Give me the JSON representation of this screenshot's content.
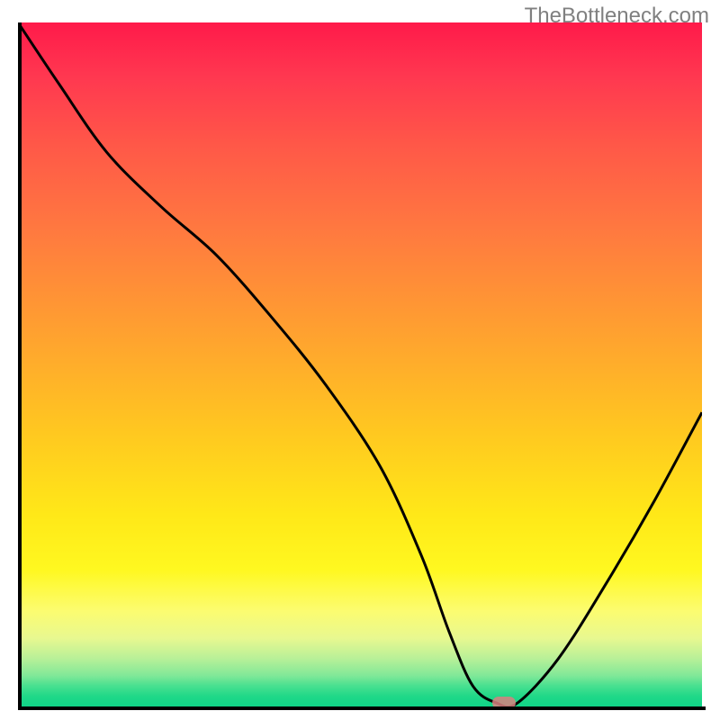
{
  "watermark": "TheBottleneck.com",
  "chart_data": {
    "type": "line",
    "title": "",
    "xlabel": "",
    "ylabel": "",
    "xlim": [
      0,
      100
    ],
    "ylim": [
      0,
      100
    ],
    "grid": false,
    "legend": false,
    "background": {
      "gradient": "vertical",
      "stops": [
        {
          "pos": 0,
          "color": "#ff1a4a"
        },
        {
          "pos": 0.5,
          "color": "#ffc820"
        },
        {
          "pos": 0.85,
          "color": "#fcfc70"
        },
        {
          "pos": 1.0,
          "color": "#10d488"
        }
      ]
    },
    "series": [
      {
        "name": "bottleneck-curve",
        "type": "line",
        "color": "#000000",
        "x": [
          0,
          6,
          13,
          21,
          29,
          37,
          45,
          53,
          59,
          63,
          66.5,
          70,
          73,
          79,
          86,
          93,
          100
        ],
        "values": [
          100,
          91,
          81,
          73,
          66,
          57,
          47,
          35,
          22,
          11,
          3,
          0.5,
          0.5,
          7,
          18,
          30,
          43
        ]
      }
    ],
    "marker": {
      "name": "optimal-point",
      "x": 71,
      "y": 0.5,
      "color": "#d98080",
      "shape": "rounded-rect"
    }
  }
}
